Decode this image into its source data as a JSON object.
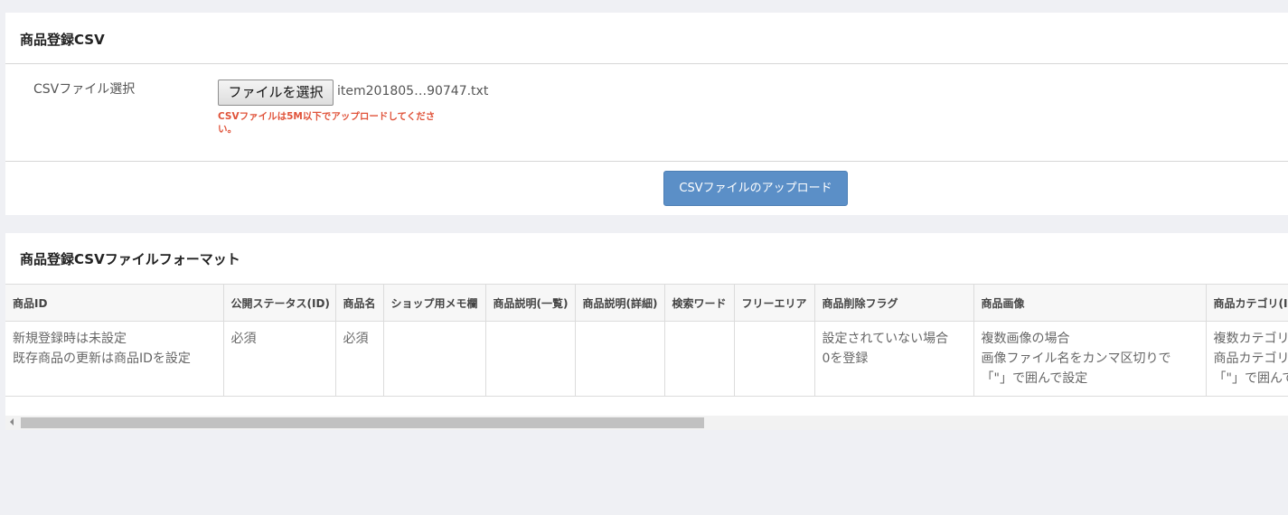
{
  "upload_panel": {
    "title": "商品登録CSV",
    "field_label": "CSVファイル選択",
    "file_button_label": "ファイルを選択",
    "selected_file": "item201805…90747.txt",
    "hint": "CSVファイルは5M以下でアップロードしてください。",
    "upload_button_label": "CSVファイルのアップロード",
    "accent_color": "#5b8fc7",
    "hint_color": "#e0533a"
  },
  "format_panel": {
    "title": "商品登録CSVファイルフォーマット",
    "columns": [
      {
        "header": "商品ID",
        "lines": [
          "新規登録時は未設定",
          "既存商品の更新は商品IDを設定"
        ]
      },
      {
        "header": "公開ステータス(ID)",
        "lines": [
          "必須"
        ]
      },
      {
        "header": "商品名",
        "lines": [
          "必須"
        ]
      },
      {
        "header": "ショップ用メモ欄",
        "lines": []
      },
      {
        "header": "商品説明(一覧)",
        "lines": []
      },
      {
        "header": "商品説明(詳細)",
        "lines": []
      },
      {
        "header": "検索ワード",
        "lines": []
      },
      {
        "header": "フリーエリア",
        "lines": []
      },
      {
        "header": "商品削除フラグ",
        "lines": [
          "設定されていない場合",
          "0を登録"
        ]
      },
      {
        "header": "商品画像",
        "lines": [
          "複数画像の場合",
          "画像ファイル名をカンマ区切りで",
          "「\"」で囲んで設定"
        ]
      },
      {
        "header": "商品カテゴリ(ID)",
        "lines": [
          "複数カテゴリの場合",
          "商品カテゴリIDをカンマ区切りで",
          "「\"」で囲んで設定"
        ]
      }
    ]
  }
}
